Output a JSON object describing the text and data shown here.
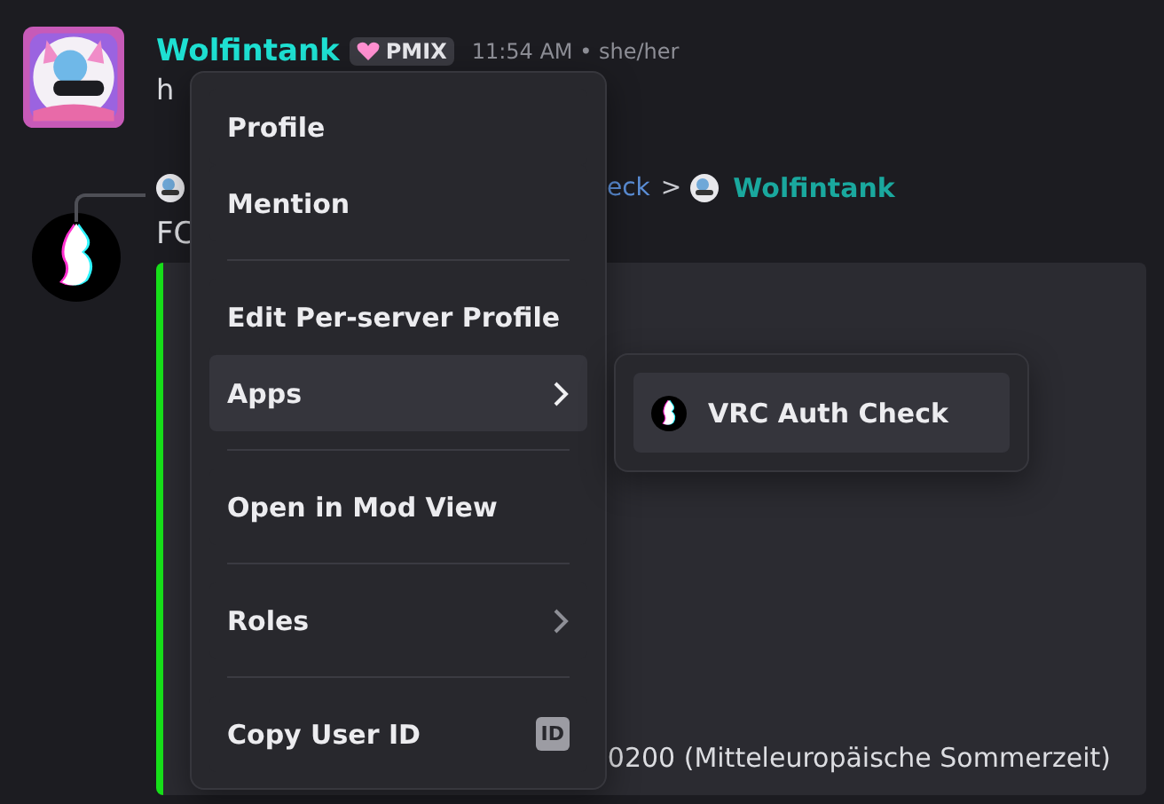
{
  "message": {
    "author": "Wolfintank",
    "badge": "PMIX",
    "meta": "11:54 AM • she/her",
    "text": "h"
  },
  "reply": {
    "fragment": "eck",
    "separator": ">",
    "author": "Wolfintank"
  },
  "message2": {
    "text": "FC",
    "embed_text": "0200 (Mitteleuropäische Sommerzeit)"
  },
  "context_menu": {
    "items": [
      {
        "kind": "item",
        "label": "Profile",
        "selected": false
      },
      {
        "kind": "item",
        "label": "Mention",
        "selected": false
      },
      {
        "kind": "separator"
      },
      {
        "kind": "item",
        "label": "Edit Per-server Profile",
        "selected": false
      },
      {
        "kind": "submenu",
        "label": "Apps",
        "selected": true
      },
      {
        "kind": "separator"
      },
      {
        "kind": "item",
        "label": "Open in Mod View",
        "selected": false
      },
      {
        "kind": "separator"
      },
      {
        "kind": "submenu",
        "label": "Roles",
        "selected": false
      },
      {
        "kind": "separator"
      },
      {
        "kind": "shortcut",
        "label": "Copy User ID",
        "shortcut": "ID",
        "selected": false
      }
    ]
  },
  "submenu": {
    "items": [
      {
        "label": "VRC Auth Check",
        "selected": true
      }
    ]
  }
}
